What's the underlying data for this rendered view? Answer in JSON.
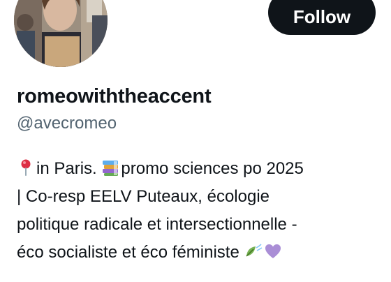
{
  "profile": {
    "display_name": "romeowiththeaccent",
    "handle": "@avecromeo",
    "follow_label": "Follow"
  },
  "bio": {
    "line1_a": "in Paris. ",
    "line1_b": "promo sciences po 2025",
    "line2": "|  Co-resp EELV Puteaux, écologie",
    "line3": "politique radicale et intersectionnelle -",
    "line4": "éco socialiste et éco féministe ",
    "icons": [
      "round-pushpin-icon",
      "books-icon",
      "leaf-fluttering-in-wind-icon",
      "purple-heart-icon"
    ]
  },
  "colors": {
    "text": "#0f1419",
    "secondary_text": "#536471",
    "button_bg": "#0f1419",
    "button_text": "#ffffff",
    "heart": "#aa8ed6",
    "leaf": "#77b255",
    "pin": "#dd2e44"
  }
}
